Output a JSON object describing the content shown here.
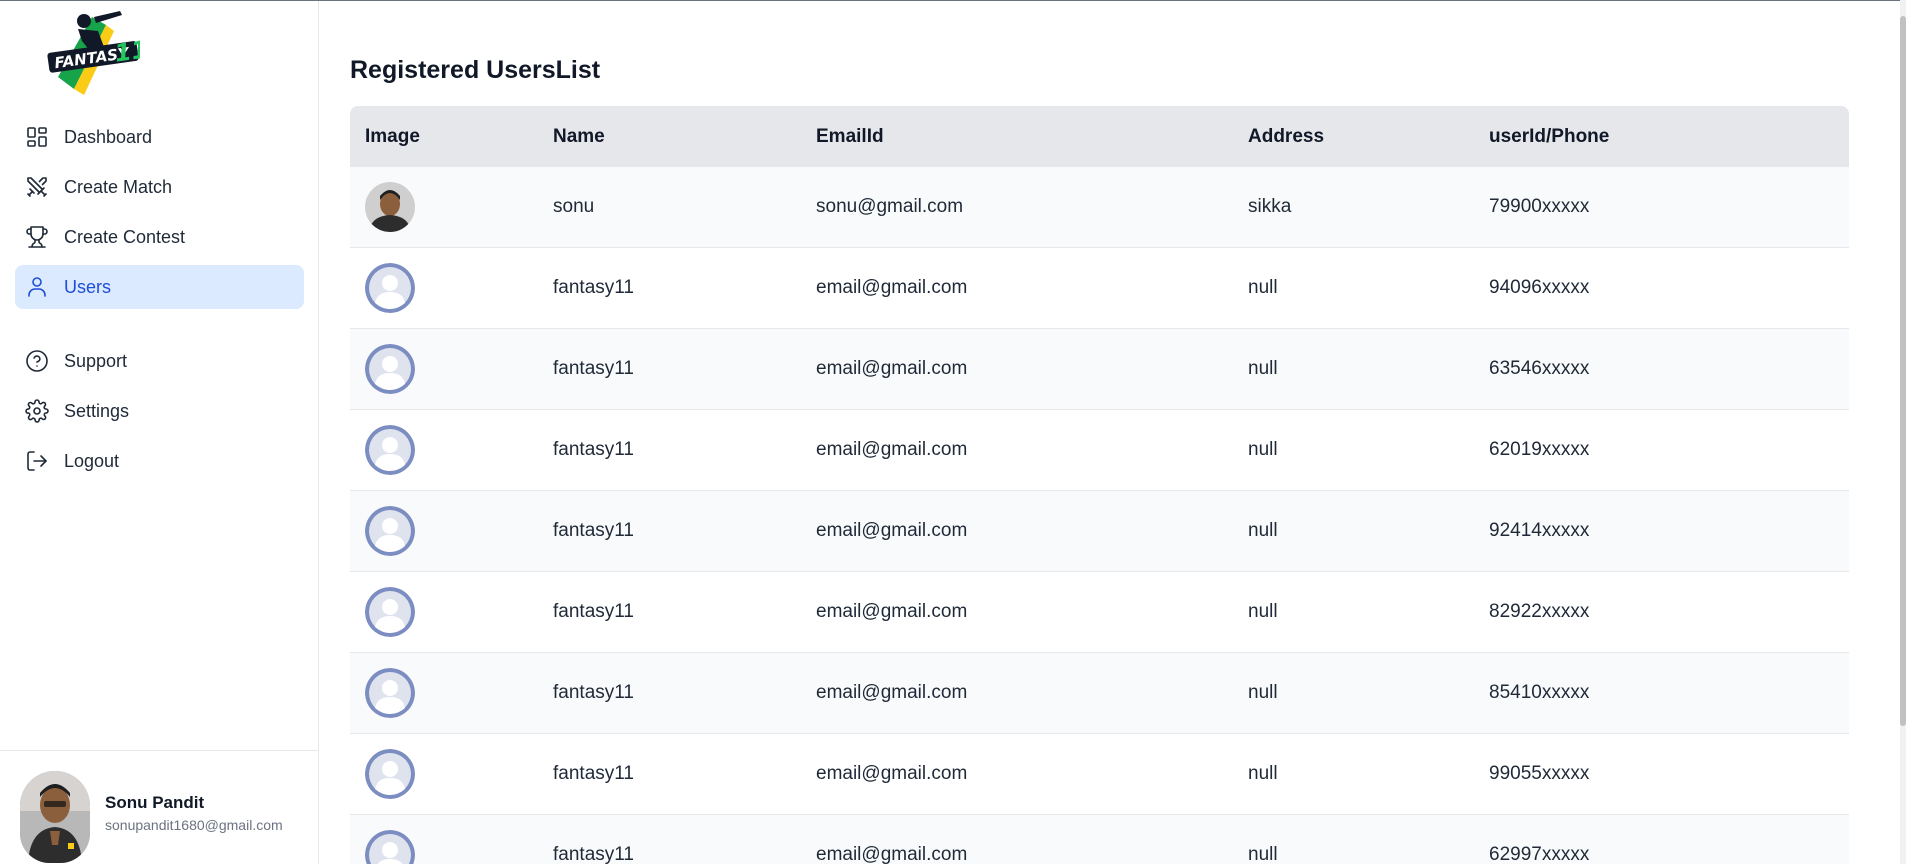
{
  "brand": {
    "logo_text": "FANTASY 11",
    "colors": {
      "green": "#16a34a",
      "dark": "#111827",
      "yellow": "#facc15"
    }
  },
  "sidebar": {
    "items": [
      {
        "label": "Dashboard",
        "icon": "dashboard-icon"
      },
      {
        "label": "Create Match",
        "icon": "crossed-swords-icon"
      },
      {
        "label": "Create Contest",
        "icon": "trophy-icon"
      },
      {
        "label": "Users",
        "icon": "user-icon",
        "active": true
      },
      {
        "label": "Support",
        "icon": "help-circle-icon"
      },
      {
        "label": "Settings",
        "icon": "gear-icon"
      },
      {
        "label": "Logout",
        "icon": "logout-icon"
      }
    ],
    "active_color": "#1d4ed8",
    "active_bg": "#dbeafe"
  },
  "profile": {
    "name": "Sonu Pandit",
    "email": "sonupandit1680@gmail.com"
  },
  "page": {
    "title": "Registered UsersList"
  },
  "table": {
    "headers": [
      "Image",
      "Name",
      "EmailId",
      "Address",
      "userId/Phone"
    ],
    "rows": [
      {
        "image": "user-photo",
        "name": "sonu",
        "email": "sonu@gmail.com",
        "address": "sikka",
        "phone": "79900xxxxx"
      },
      {
        "image": "default-avatar",
        "name": "fantasy11",
        "email": "email@gmail.com",
        "address": "null",
        "phone": "94096xxxxx"
      },
      {
        "image": "default-avatar",
        "name": "fantasy11",
        "email": "email@gmail.com",
        "address": "null",
        "phone": "63546xxxxx"
      },
      {
        "image": "default-avatar",
        "name": "fantasy11",
        "email": "email@gmail.com",
        "address": "null",
        "phone": "62019xxxxx"
      },
      {
        "image": "default-avatar",
        "name": "fantasy11",
        "email": "email@gmail.com",
        "address": "null",
        "phone": "92414xxxxx"
      },
      {
        "image": "default-avatar",
        "name": "fantasy11",
        "email": "email@gmail.com",
        "address": "null",
        "phone": "82922xxxxx"
      },
      {
        "image": "default-avatar",
        "name": "fantasy11",
        "email": "email@gmail.com",
        "address": "null",
        "phone": "85410xxxxx"
      },
      {
        "image": "default-avatar",
        "name": "fantasy11",
        "email": "email@gmail.com",
        "address": "null",
        "phone": "99055xxxxx"
      },
      {
        "image": "default-avatar",
        "name": "fantasy11",
        "email": "email@gmail.com",
        "address": "null",
        "phone": "62997xxxxx"
      }
    ]
  }
}
